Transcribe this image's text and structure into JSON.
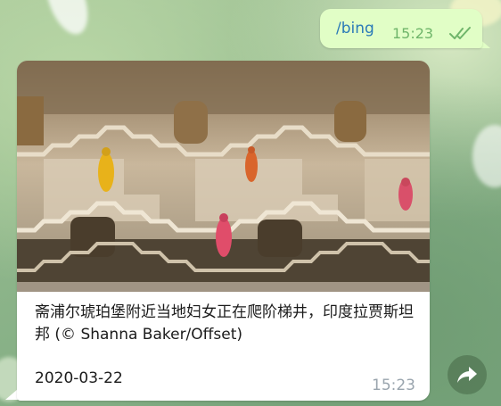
{
  "outgoing_message": {
    "text": "/bing",
    "time": "15:23",
    "status_icon": "double-check-icon",
    "bubble_color": "#e1fec6",
    "text_color": "#2a7ab8",
    "time_color": "#6fb56a"
  },
  "incoming_message": {
    "image_alt": "stepwell-photo",
    "caption": "斋浦尔琥珀堡附近当地妇女正在爬阶梯井，印度拉贾斯坦邦 (© Shanna Baker/Offset)",
    "date": "2020-03-22",
    "time": "15:23",
    "bubble_color": "#ffffff",
    "time_color": "#9aa5ae"
  },
  "forward_button": {
    "icon": "forward-arrow-icon"
  }
}
